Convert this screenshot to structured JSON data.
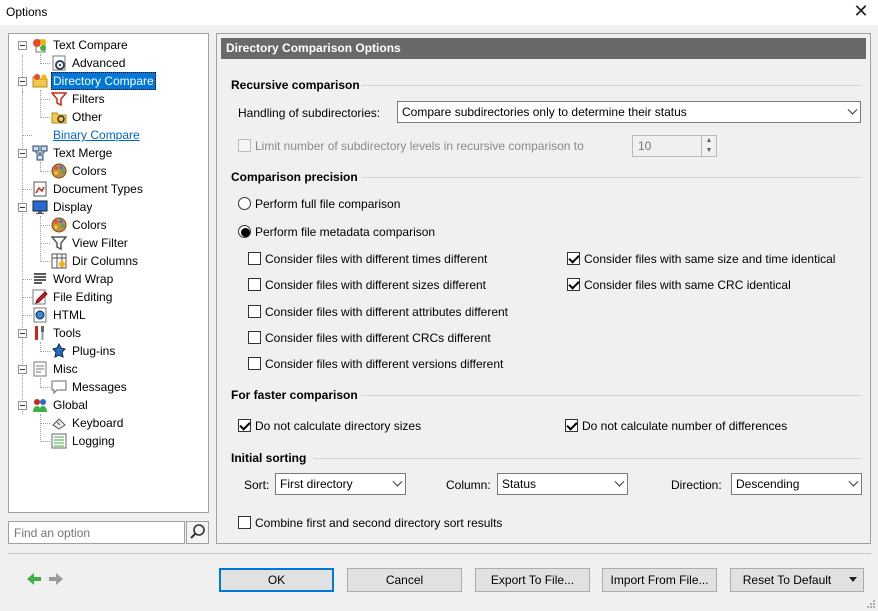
{
  "window": {
    "title": "Options",
    "close_glyph": "✕"
  },
  "tree": {
    "items": [
      {
        "label": "Text Compare",
        "icon": "text-compare-icon"
      },
      {
        "label": "Advanced",
        "icon": "gear-icon"
      },
      {
        "label": "Directory Compare",
        "icon": "folder-compare-icon"
      },
      {
        "label": "Filters",
        "icon": "filter-icon"
      },
      {
        "label": "Other",
        "icon": "folder-gear-icon"
      },
      {
        "label": "Binary Compare",
        "icon": ""
      },
      {
        "label": "Text Merge",
        "icon": "merge-icon"
      },
      {
        "label": "Colors",
        "icon": "palette-icon"
      },
      {
        "label": "Document Types",
        "icon": "document-types-icon"
      },
      {
        "label": "Display",
        "icon": "monitor-icon"
      },
      {
        "label": "Colors",
        "icon": "palette-icon"
      },
      {
        "label": "View Filter",
        "icon": "filter-icon"
      },
      {
        "label": "Dir Columns",
        "icon": "columns-icon"
      },
      {
        "label": "Word Wrap",
        "icon": "word-wrap-icon"
      },
      {
        "label": "File Editing",
        "icon": "pencil-icon"
      },
      {
        "label": "HTML",
        "icon": "html-icon"
      },
      {
        "label": "Tools",
        "icon": "tools-icon"
      },
      {
        "label": "Plug-ins",
        "icon": "plugin-icon"
      },
      {
        "label": "Misc",
        "icon": "misc-icon"
      },
      {
        "label": "Messages",
        "icon": "message-icon"
      },
      {
        "label": "Global",
        "icon": "users-icon"
      },
      {
        "label": "Keyboard",
        "icon": "keyboard-icon"
      },
      {
        "label": "Logging",
        "icon": "log-icon"
      }
    ]
  },
  "search": {
    "placeholder": "Find an option",
    "icon": "search-icon"
  },
  "panel": {
    "title": "Directory Comparison Options",
    "recursive": {
      "heading": "Recursive comparison",
      "subdir_label": "Handling of subdirectories:",
      "subdir_value": "Compare subdirectories only to determine their status",
      "limit_label": "Limit number of subdirectory levels in recursive comparison to",
      "limit_checked": false,
      "limit_value": "10"
    },
    "precision": {
      "heading": "Comparison precision",
      "full_label": "Perform full file comparison",
      "metadata_label": "Perform file metadata comparison",
      "left_options": [
        {
          "label": "Consider files with different times different",
          "checked": false
        },
        {
          "label": "Consider files with different sizes different",
          "checked": false
        },
        {
          "label": "Consider files with different attributes different",
          "checked": false
        },
        {
          "label": "Consider files with different CRCs different",
          "checked": false
        },
        {
          "label": "Consider files with different versions different",
          "checked": false
        }
      ],
      "right_options": [
        {
          "label": "Consider files with same size and time identical",
          "checked": true
        },
        {
          "label": "Consider files with same CRC identical",
          "checked": true
        }
      ]
    },
    "faster": {
      "heading": "For faster comparison",
      "dir_sizes_label": "Do not calculate directory sizes",
      "dir_sizes_checked": true,
      "num_diff_label": "Do not calculate number of differences",
      "num_diff_checked": true
    },
    "sorting": {
      "heading": "Initial sorting",
      "sort_label": "Sort:",
      "sort_value": "First directory",
      "column_label": "Column:",
      "column_value": "Status",
      "direction_label": "Direction:",
      "direction_value": "Descending",
      "combine_label": "Combine first and second directory sort results",
      "combine_checked": false
    }
  },
  "buttons": {
    "ok": "OK",
    "cancel": "Cancel",
    "export": "Export To File...",
    "import": "Import From File...",
    "reset": "Reset To Default"
  },
  "colors": {
    "accent": "#0078d7",
    "header": "#696969",
    "back_arrow": "#3cb043",
    "forward_arrow": "#9a9a9a"
  }
}
